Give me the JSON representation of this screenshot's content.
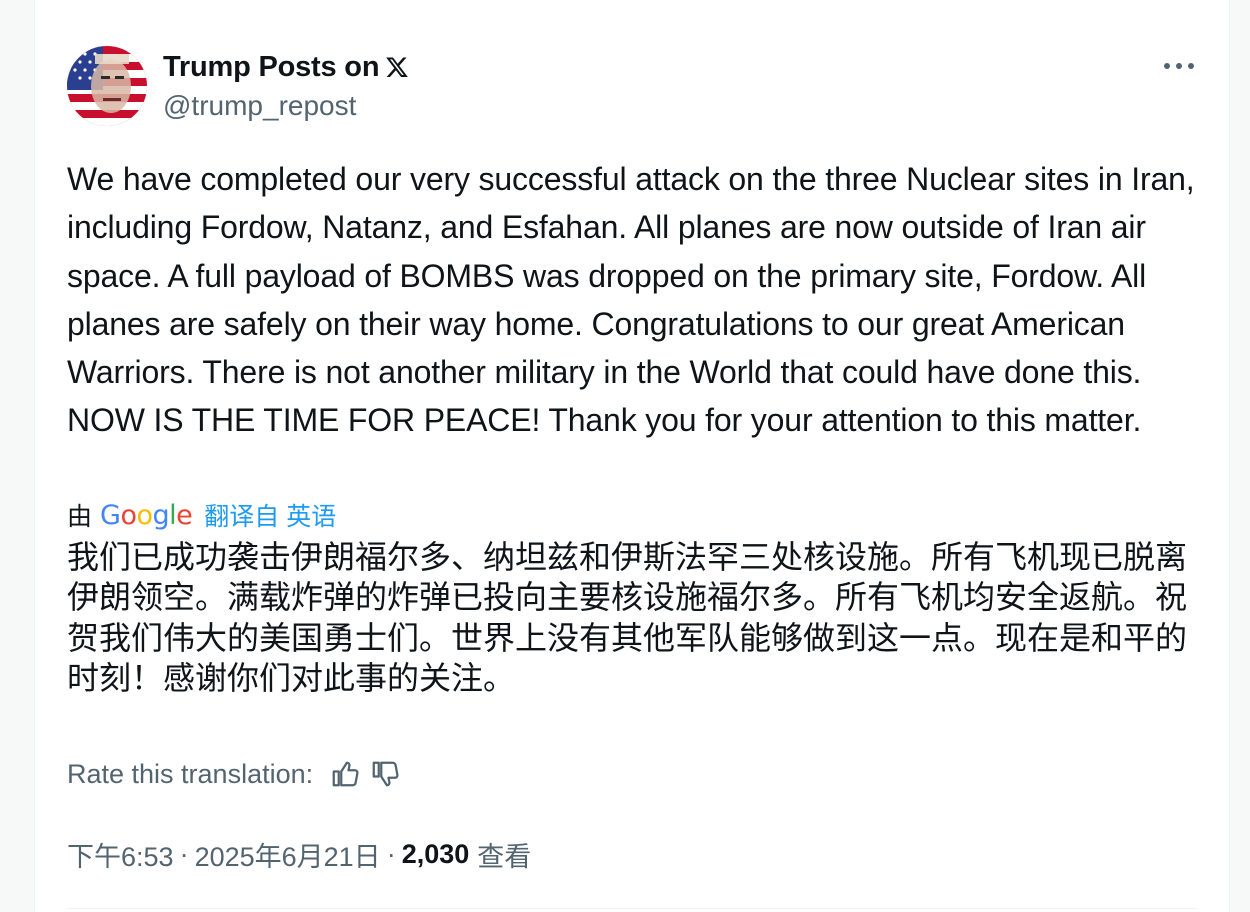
{
  "author": {
    "display_name": "Trump Posts on",
    "handle": "@trump_repost",
    "avatar_icon": "flag-portrait-avatar",
    "badge_icon": "x-logo-icon"
  },
  "tweet": {
    "text": "We have completed our very successful attack on the three Nuclear sites in Iran, including Fordow, Natanz, and Esfahan. All planes are now outside of Iran air space. A full payload of BOMBS was dropped on the primary site, Fordow. All planes are safely on their way home. Congratulations to our great American Warriors. There is not another military in the World that could have done this. NOW IS THE TIME FOR PEACE! Thank you for your attention to this matter."
  },
  "translation": {
    "by_label": "由",
    "provider": "Google",
    "from_label": "翻译自 英语",
    "text": "我们已成功袭击伊朗福尔多、纳坦兹和伊斯法罕三处核设施。所有飞机现已脱离伊朗领空。满载炸弹的炸弹已投向主要核设施福尔多。所有飞机均安全返航。祝贺我们伟大的美国勇士们。世界上没有其他军队能够做到这一点。现在是和平的时刻！感谢你们对此事的关注。",
    "rate_label": "Rate this translation:"
  },
  "meta": {
    "time": "下午6:53",
    "separator": "·",
    "date": "2025年6月21日",
    "views": "2,030",
    "views_label": "查看"
  },
  "colors": {
    "accent": "#1d9bf0",
    "secondary_text": "#536471",
    "primary_text": "#0f1419"
  }
}
